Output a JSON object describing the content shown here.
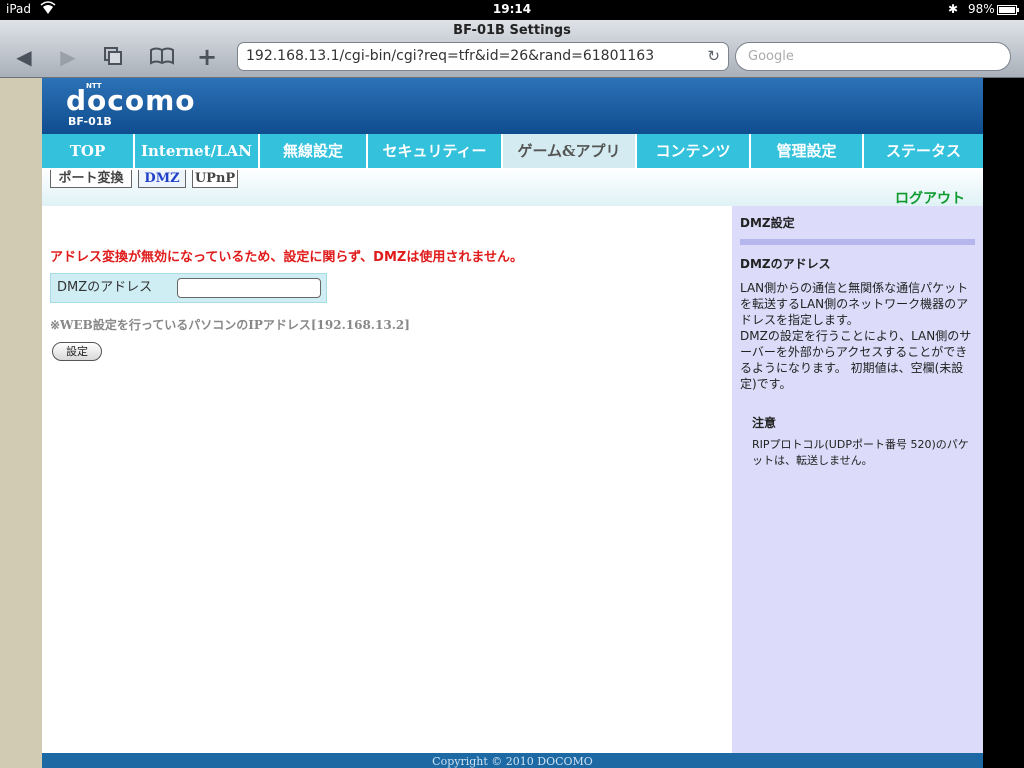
{
  "status_bar": {
    "device": "iPad",
    "time": "19:14",
    "battery": "98%"
  },
  "browser": {
    "window_title": "BF-01B Settings",
    "url": "192.168.13.1/cgi-bin/cgi?req=tfr&id=26&rand=61801163",
    "search_placeholder": "Google"
  },
  "site": {
    "brand": "docomo",
    "brand_super": "NTT",
    "model": "BF-01B",
    "nav": [
      {
        "label": "TOP"
      },
      {
        "label": "Internet/LAN"
      },
      {
        "label": "無線設定"
      },
      {
        "label": "セキュリティー"
      },
      {
        "label": "ゲーム&アプリ",
        "active": true
      },
      {
        "label": "コンテンツ"
      },
      {
        "label": "管理設定"
      },
      {
        "label": "ステータス"
      }
    ],
    "subnav": [
      {
        "label": "ポート変換"
      },
      {
        "label": "DMZ",
        "active": true
      },
      {
        "label": "UPnP"
      }
    ],
    "logout": "ログアウト"
  },
  "main": {
    "warning": "アドレス変換が無効になっているため、設定に関らず、DMZは使用されません。",
    "dmz_label": "DMZのアドレス",
    "dmz_value": "",
    "note": "※WEB設定を行っているパソコンのIPアドレス[192.168.13.2]",
    "submit": "設定"
  },
  "sidebar": {
    "title": "DMZ設定",
    "subtitle": "DMZのアドレス",
    "para1": "LAN側からの通信と無関係な通信パケットを転送するLAN側のネットワーク機器のアドレスを指定します。",
    "para2": "DMZの設定を行うことにより、LAN側のサーバーを外部からアクセスすることができるようになります。 初期値は、空欄(未設定)です。",
    "note_title": "注意",
    "note_text": "RIPプロトコル(UDPポート番号 520)のパケットは、転送しません。"
  },
  "footer": "Copyright © 2010 DOCOMO",
  "colors": {
    "nav": "#33c1dc",
    "header": "#1a5fa3",
    "warning": "#e01b1b",
    "logout": "#0e9b2e",
    "sidebar": "#dcdcfa"
  }
}
